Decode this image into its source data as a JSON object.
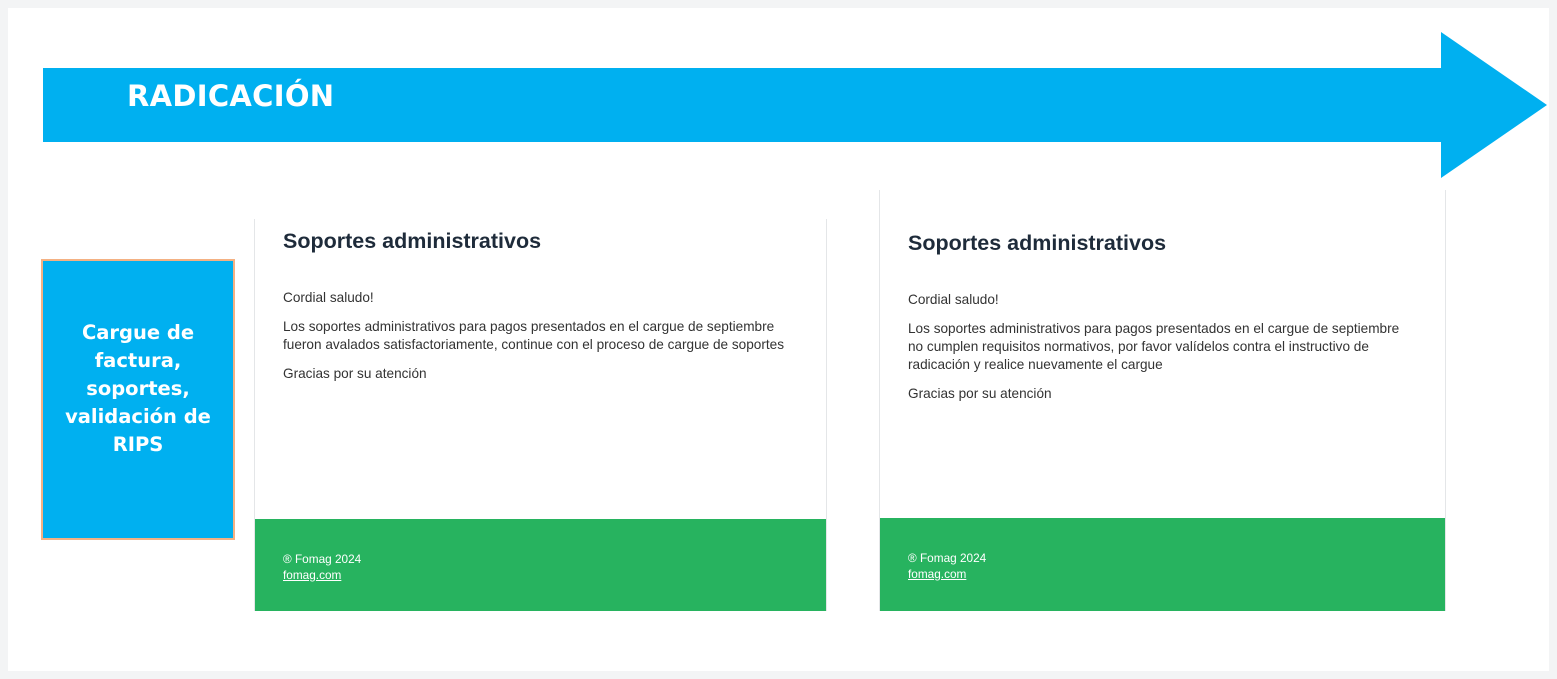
{
  "stage": {
    "title": "RADICACIÓN"
  },
  "step": {
    "label": "Cargue de factura, soportes, validación de RIPS"
  },
  "cards": [
    {
      "title": "Soportes administrativos",
      "greeting": "Cordial saludo!",
      "message": "Los soportes administrativos para pagos presentados en el cargue de septiembre fueron avalados satisfactoriamente, continue con el proceso de cargue de soportes",
      "closing": "Gracias por su atención",
      "footer_copyright": "® Fomag 2024",
      "footer_link": "fomag.com"
    },
    {
      "title": "Soportes administrativos",
      "greeting": "Cordial saludo!",
      "message": "Los soportes administrativos para pagos presentados en el cargue de septiembre no cumplen requisitos normativos, por favor valídelos contra el instructivo de radicación y realice nuevamente el cargue",
      "closing": "Gracias por su atención",
      "footer_copyright": "® Fomag 2024",
      "footer_link": "fomag.com"
    }
  ],
  "colors": {
    "arrow": "#00b0f0",
    "step_box": "#00b0f0",
    "step_border": "#f4b183",
    "footer": "#27b35f",
    "card_title": "#1e2b3a"
  }
}
